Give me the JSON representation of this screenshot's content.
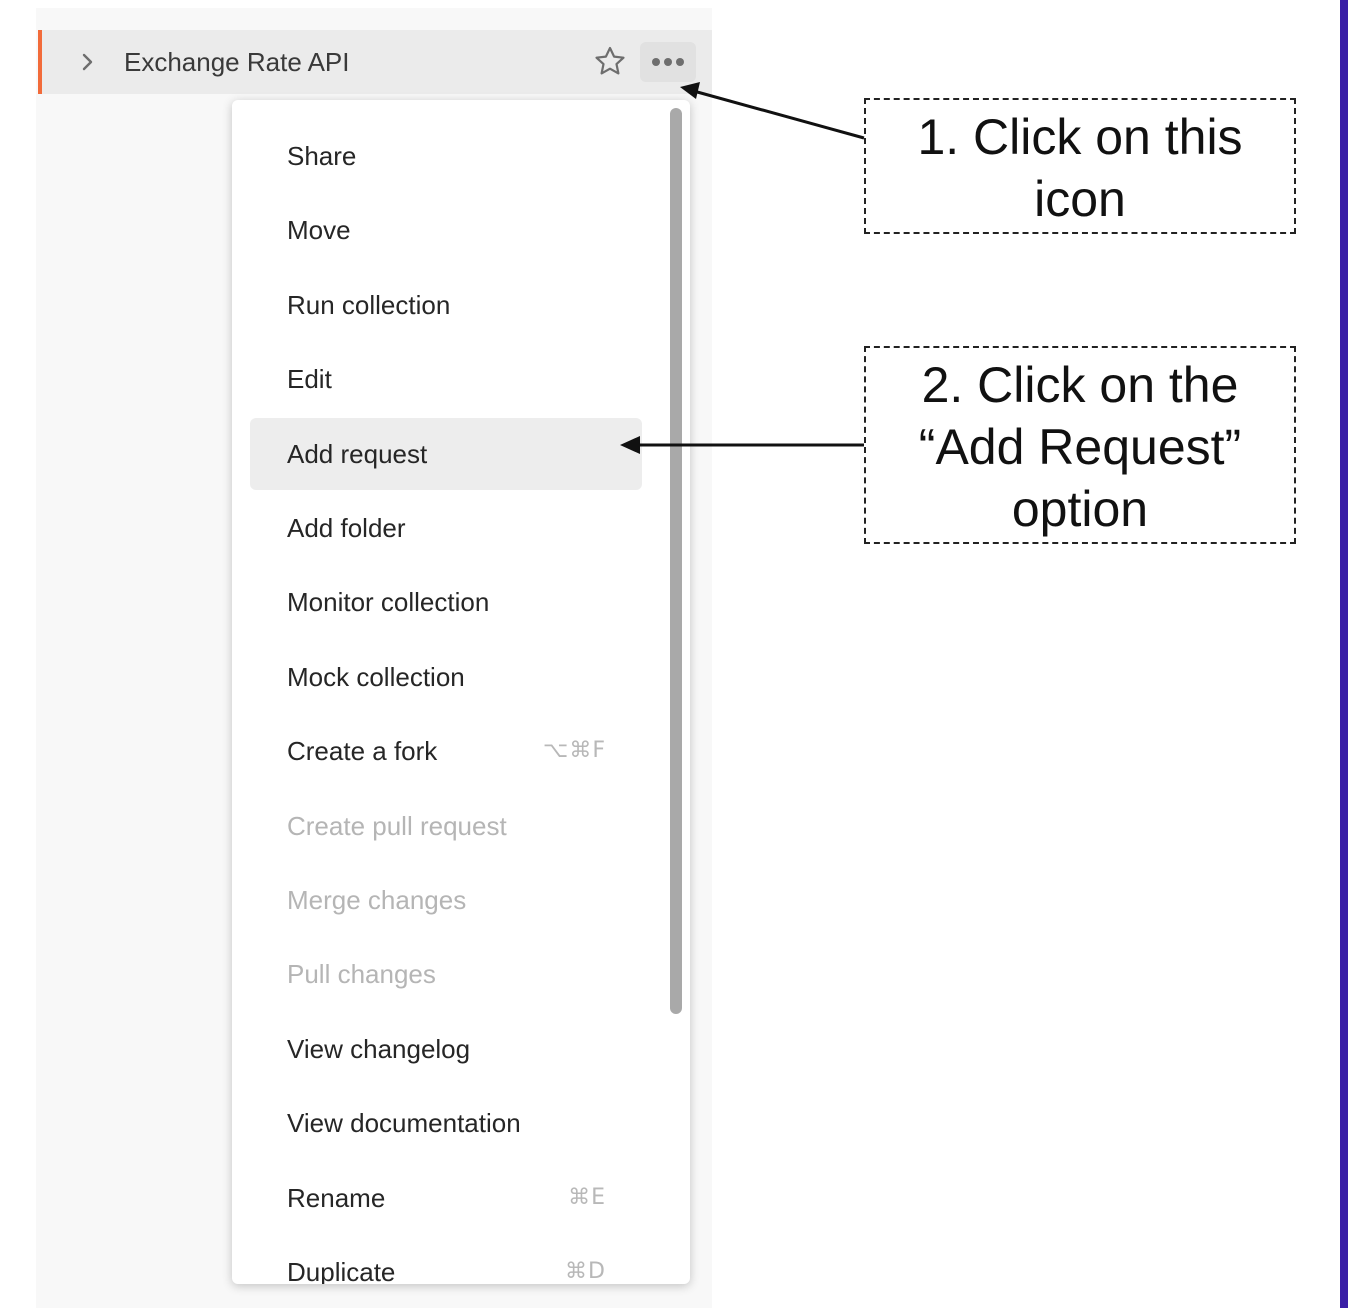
{
  "collection": {
    "name": "Exchange Rate API",
    "chevron_icon": "chevron-right-icon",
    "star_icon": "star-outline-icon",
    "more_icon": "more-horizontal-icon",
    "accent_color": "#f26b3a"
  },
  "menu": {
    "items": [
      {
        "label": "Share",
        "shortcut": "",
        "disabled": false,
        "highlighted": false
      },
      {
        "label": "Move",
        "shortcut": "",
        "disabled": false,
        "highlighted": false
      },
      {
        "label": "Run collection",
        "shortcut": "",
        "disabled": false,
        "highlighted": false
      },
      {
        "label": "Edit",
        "shortcut": "",
        "disabled": false,
        "highlighted": false
      },
      {
        "label": "Add request",
        "shortcut": "",
        "disabled": false,
        "highlighted": true
      },
      {
        "label": "Add folder",
        "shortcut": "",
        "disabled": false,
        "highlighted": false
      },
      {
        "label": "Monitor collection",
        "shortcut": "",
        "disabled": false,
        "highlighted": false
      },
      {
        "label": "Mock collection",
        "shortcut": "",
        "disabled": false,
        "highlighted": false
      },
      {
        "label": "Create a fork",
        "shortcut": "⌥⌘F",
        "disabled": false,
        "highlighted": false
      },
      {
        "label": "Create pull request",
        "shortcut": "",
        "disabled": true,
        "highlighted": false
      },
      {
        "label": "Merge changes",
        "shortcut": "",
        "disabled": true,
        "highlighted": false
      },
      {
        "label": "Pull changes",
        "shortcut": "",
        "disabled": true,
        "highlighted": false
      },
      {
        "label": "View changelog",
        "shortcut": "",
        "disabled": false,
        "highlighted": false
      },
      {
        "label": "View documentation",
        "shortcut": "",
        "disabled": false,
        "highlighted": false
      },
      {
        "label": "Rename",
        "shortcut": "⌘E",
        "disabled": false,
        "highlighted": false
      },
      {
        "label": "Duplicate",
        "shortcut": "⌘D",
        "disabled": false,
        "highlighted": false
      }
    ]
  },
  "annotations": {
    "callout_1": {
      "lines": [
        "1. Click on this",
        "icon"
      ]
    },
    "callout_2": {
      "lines": [
        "2. Click on the",
        "“Add Request”",
        "option"
      ]
    }
  }
}
